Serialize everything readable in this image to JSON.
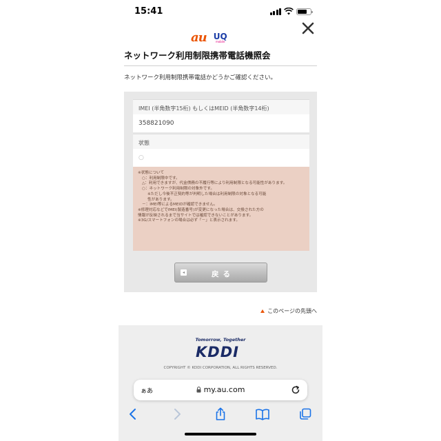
{
  "status_bar": {
    "time": "15:41"
  },
  "header": {
    "au_logo": "au",
    "uq_logo": "UQ",
    "uq_sub": "mobile",
    "title": "ネットワーク利用制限携帯電話機照会"
  },
  "intro": "ネットワーク利用制限携帯電話かどうかご確認ください。",
  "form": {
    "imei_label": "IMEI (半角数字15桁) もしくはMEID (半角数字14桁)",
    "imei_value": "358821090",
    "status_label": "状態",
    "status_value": "○"
  },
  "notes": [
    {
      "text": "※状態について",
      "indent": 0
    },
    {
      "text": "○：利用制限中です。",
      "indent": 1
    },
    {
      "text": "△：利用できますが、代金債務の不履行等により利用制限となる可能性があります。",
      "indent": 1
    },
    {
      "text": "○：ネットワーク利用制限の対象外です。",
      "indent": 1
    },
    {
      "text": "※ただし今後不正契約等が判明した場合は利用制限の対象となる可能",
      "indent": 2
    },
    {
      "text": "性があります。",
      "indent": 2
    },
    {
      "text": "－：IMEI等によるMEIDが確認できません。",
      "indent": 1
    },
    {
      "text": "※修理対応などでIMEI(製造番号)が変更になった場合は、交換された方の",
      "indent": 0
    },
    {
      "text": "情報が反映されるまで当サイトでは確認できないことがあります。",
      "indent": 0
    },
    {
      "text": "※3G/スマートフォンの場合は必ず「－」と表示されます。",
      "indent": 0
    }
  ],
  "back_button": {
    "label": "戻る",
    "mark": "◂"
  },
  "page_top_link": "このページの先頭へ",
  "footer": {
    "tagline": "Tomorrow, Together",
    "logo": "KDDI",
    "copyright": "COPYRIGHT © KDDI CORPORATION, ALL RIGHTS RESERVED."
  },
  "browser": {
    "aa": "ぁあ",
    "url": "my.au.com"
  },
  "colors": {
    "au_orange": "#eb5505",
    "uq_blue": "#1d3ea7",
    "kddi_navy": "#1b2b66",
    "notes_bg": "#ebd0c4",
    "ios_blue": "#1a73e8"
  },
  "icons": {
    "close": "close-icon",
    "reload": "reload-icon",
    "back": "back-arrow-icon",
    "forward": "forward-arrow-icon",
    "share": "share-icon",
    "bookmarks": "book-icon",
    "tabs": "tabs-icon"
  }
}
